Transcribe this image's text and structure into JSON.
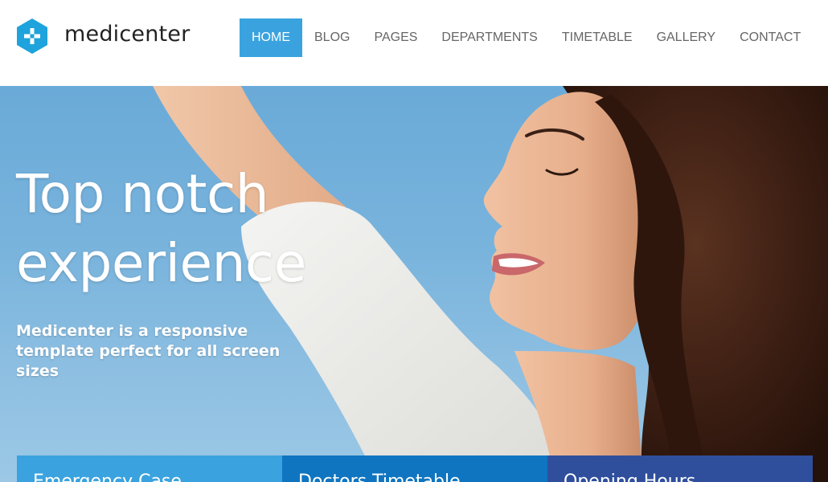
{
  "header": {
    "logo_text": "medicenter"
  },
  "nav": {
    "items": [
      {
        "label": "HOME",
        "active": true
      },
      {
        "label": "BLOG",
        "active": false
      },
      {
        "label": "PAGES",
        "active": false
      },
      {
        "label": "DEPARTMENTS",
        "active": false
      },
      {
        "label": "TIMETABLE",
        "active": false
      },
      {
        "label": "GALLERY",
        "active": false
      },
      {
        "label": "CONTACT",
        "active": false
      }
    ]
  },
  "hero": {
    "title_line1": "Top notch",
    "title_line2": "experience",
    "subtitle": "Medicenter is a responsive template perfect for all screen sizes"
  },
  "info_boxes": [
    {
      "label": "Emergency Case",
      "color": "#3aa3df"
    },
    {
      "label": "Doctors Timetable",
      "color": "#0f75c0"
    },
    {
      "label": "Opening Hours",
      "color": "#2f4f9d"
    }
  ],
  "colors": {
    "accent": "#3aa3df",
    "nav_text": "#666666",
    "logo_hex": "#1ea3dc"
  }
}
